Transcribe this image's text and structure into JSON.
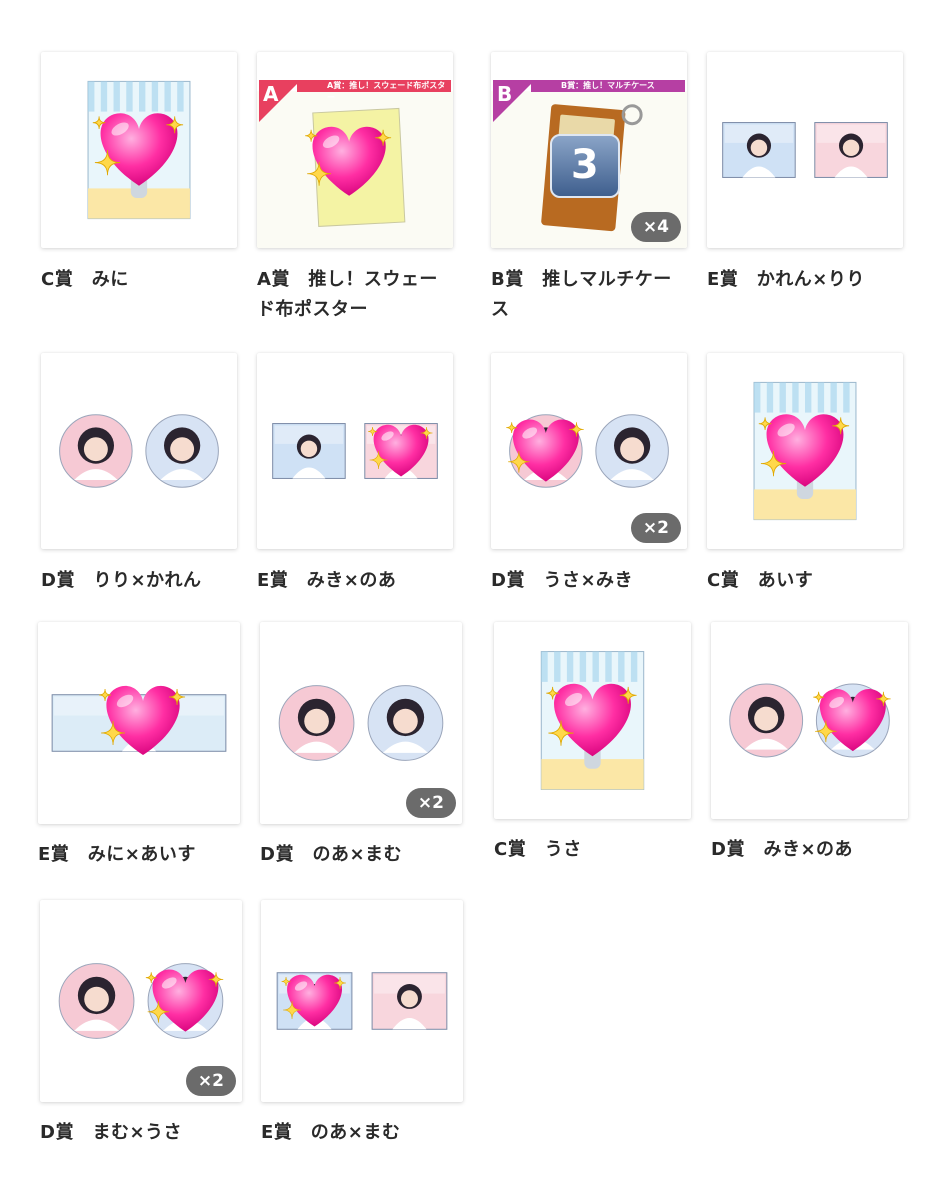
{
  "items": [
    {
      "caption": "C賞　みに",
      "visual": "acrylic-stand",
      "heart": true
    },
    {
      "caption": "A賞　推し！スウェード布ポスター",
      "visual": "poster",
      "heart": true,
      "banner": {
        "letter": "A",
        "text": "A賞：推し！スウェード布ポスター",
        "color": "#e8405f"
      }
    },
    {
      "caption": "B賞　推しマルチケース",
      "visual": "multicase",
      "badge": "3",
      "qty": "×4",
      "banner": {
        "letter": "B",
        "text": "B賞：推し！マルチケース",
        "color": "#b63fa3"
      }
    },
    {
      "caption": "E賞　かれん×りり",
      "visual": "two-rect"
    },
    {
      "caption": "D賞　りり×かれん",
      "visual": "two-circle"
    },
    {
      "caption": "E賞　みき×のあ",
      "visual": "two-rect",
      "heart_on": 1
    },
    {
      "caption": "D賞　うさ×みき",
      "visual": "two-circle",
      "heart_on": 0,
      "qty": "×2"
    },
    {
      "caption": "C賞　あいす",
      "visual": "acrylic-stand",
      "heart": true
    },
    {
      "caption": "E賞　みに×あいす",
      "visual": "wide-rect",
      "heart": true
    },
    {
      "caption": "D賞　のあ×まむ",
      "visual": "two-circle",
      "qty": "×2"
    },
    {
      "caption": "C賞　うさ",
      "visual": "acrylic-stand",
      "heart": true
    },
    {
      "caption": "D賞　みき×のあ",
      "visual": "two-circle",
      "heart_on": 1
    },
    {
      "caption": "D賞　まむ×うさ",
      "visual": "two-circle",
      "heart_on": 1,
      "qty": "×2"
    },
    {
      "caption": "E賞　のあ×まむ",
      "visual": "two-rect",
      "heart_on": 0
    }
  ],
  "colors": {
    "caption": "#2a2a2a",
    "qty_bg": "#6b6b6b",
    "heart": "#ff2ea3",
    "sparkle": "#ffd84a"
  }
}
